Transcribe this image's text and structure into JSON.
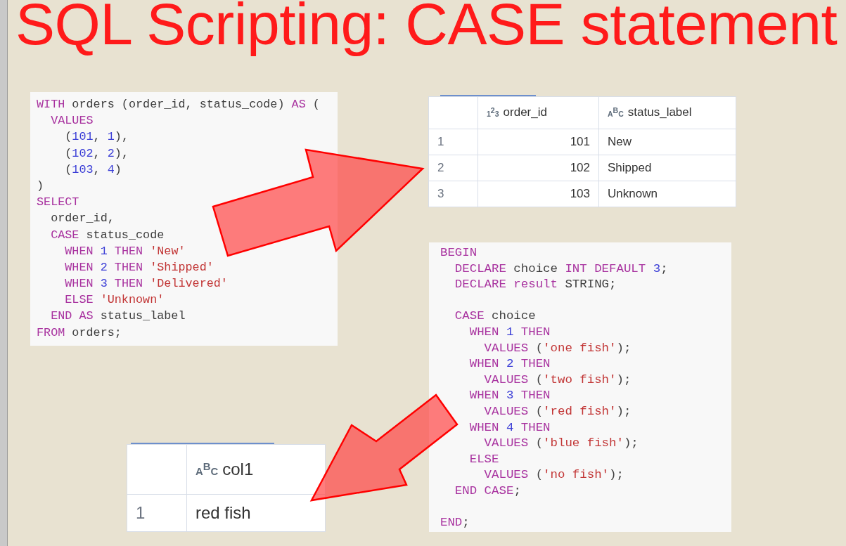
{
  "slide": {
    "title": "SQL Scripting: CASE statement",
    "code_blocks": [
      {
        "lines": [
          {
            "kind": "code",
            "tokens": [
              {
                "kind": "kw",
                "text": "WITH"
              },
              {
                "kind": "plain",
                "text": " orders (order_id, status_code) "
              },
              {
                "kind": "kw",
                "text": "AS"
              },
              {
                "kind": "plain",
                "text": " ("
              }
            ]
          },
          {
            "kind": "code",
            "tokens": [
              {
                "kind": "kw",
                "text": "  VALUES"
              }
            ]
          },
          {
            "kind": "code",
            "tokens": [
              {
                "kind": "plain",
                "text": "    ("
              },
              {
                "kind": "num",
                "text": "101"
              },
              {
                "kind": "plain",
                "text": ", "
              },
              {
                "kind": "num",
                "text": "1"
              },
              {
                "kind": "plain",
                "text": "),"
              }
            ]
          },
          {
            "kind": "code",
            "tokens": [
              {
                "kind": "plain",
                "text": "    ("
              },
              {
                "kind": "num",
                "text": "102"
              },
              {
                "kind": "plain",
                "text": ", "
              },
              {
                "kind": "num",
                "text": "2"
              },
              {
                "kind": "plain",
                "text": "),"
              }
            ]
          },
          {
            "kind": "code",
            "tokens": [
              {
                "kind": "plain",
                "text": "    ("
              },
              {
                "kind": "num",
                "text": "103"
              },
              {
                "kind": "plain",
                "text": ", "
              },
              {
                "kind": "num",
                "text": "4"
              },
              {
                "kind": "plain",
                "text": ")"
              }
            ]
          },
          {
            "kind": "code",
            "tokens": [
              {
                "kind": "plain",
                "text": ")"
              }
            ]
          },
          {
            "kind": "code",
            "tokens": [
              {
                "kind": "kw",
                "text": "SELECT"
              }
            ]
          },
          {
            "kind": "code",
            "tokens": [
              {
                "kind": "plain",
                "text": "  order_id,"
              }
            ]
          },
          {
            "kind": "code",
            "tokens": [
              {
                "kind": "kw",
                "text": "  CASE"
              },
              {
                "kind": "plain",
                "text": " status_code"
              }
            ]
          },
          {
            "kind": "code",
            "tokens": [
              {
                "kind": "kw",
                "text": "    WHEN"
              },
              {
                "kind": "num",
                "text": " 1"
              },
              {
                "kind": "kw",
                "text": " THEN"
              },
              {
                "kind": "str",
                "text": " 'New'"
              }
            ]
          },
          {
            "kind": "code",
            "tokens": [
              {
                "kind": "kw",
                "text": "    WHEN"
              },
              {
                "kind": "num",
                "text": " 2"
              },
              {
                "kind": "kw",
                "text": " THEN"
              },
              {
                "kind": "str",
                "text": " 'Shipped'"
              }
            ]
          },
          {
            "kind": "code",
            "tokens": [
              {
                "kind": "kw",
                "text": "    WHEN"
              },
              {
                "kind": "num",
                "text": " 3"
              },
              {
                "kind": "kw",
                "text": " THEN"
              },
              {
                "kind": "str",
                "text": " 'Delivered'"
              }
            ]
          },
          {
            "kind": "code",
            "tokens": [
              {
                "kind": "kw",
                "text": "    ELSE"
              },
              {
                "kind": "str",
                "text": " 'Unknown'"
              }
            ]
          },
          {
            "kind": "code",
            "tokens": [
              {
                "kind": "kw",
                "text": "  END AS"
              },
              {
                "kind": "plain",
                "text": " status_label"
              }
            ]
          },
          {
            "kind": "code",
            "tokens": [
              {
                "kind": "kw",
                "text": "FROM"
              },
              {
                "kind": "plain",
                "text": " orders;"
              }
            ]
          }
        ]
      },
      {
        "lines": [
          {
            "kind": "code",
            "tokens": [
              {
                "kind": "kw",
                "text": "BEGIN"
              }
            ]
          },
          {
            "kind": "code",
            "tokens": [
              {
                "kind": "kw",
                "text": "  DECLARE"
              },
              {
                "kind": "plain",
                "text": " choice "
              },
              {
                "kind": "kw",
                "text": "INT DEFAULT"
              },
              {
                "kind": "num",
                "text": " 3"
              },
              {
                "kind": "plain",
                "text": ";"
              }
            ]
          },
          {
            "kind": "code",
            "tokens": [
              {
                "kind": "kw",
                "text": "  DECLARE result"
              },
              {
                "kind": "plain",
                "text": " STRING;"
              }
            ]
          },
          {
            "kind": "blank"
          },
          {
            "kind": "code",
            "tokens": [
              {
                "kind": "kw",
                "text": "  CASE"
              },
              {
                "kind": "plain",
                "text": " choice"
              }
            ]
          },
          {
            "kind": "code",
            "tokens": [
              {
                "kind": "kw",
                "text": "    WHEN"
              },
              {
                "kind": "num",
                "text": " 1"
              },
              {
                "kind": "kw",
                "text": " THEN"
              }
            ]
          },
          {
            "kind": "code",
            "tokens": [
              {
                "kind": "kw",
                "text": "      VALUES"
              },
              {
                "kind": "plain",
                "text": " ("
              },
              {
                "kind": "str",
                "text": "'one fish'"
              },
              {
                "kind": "plain",
                "text": ");"
              }
            ]
          },
          {
            "kind": "code",
            "tokens": [
              {
                "kind": "kw",
                "text": "    WHEN"
              },
              {
                "kind": "num",
                "text": " 2"
              },
              {
                "kind": "kw",
                "text": " THEN"
              }
            ]
          },
          {
            "kind": "code",
            "tokens": [
              {
                "kind": "kw",
                "text": "      VALUES"
              },
              {
                "kind": "plain",
                "text": " ("
              },
              {
                "kind": "str",
                "text": "'two fish'"
              },
              {
                "kind": "plain",
                "text": ");"
              }
            ]
          },
          {
            "kind": "code",
            "tokens": [
              {
                "kind": "kw",
                "text": "    WHEN"
              },
              {
                "kind": "num",
                "text": " 3"
              },
              {
                "kind": "kw",
                "text": " THEN"
              }
            ]
          },
          {
            "kind": "code",
            "tokens": [
              {
                "kind": "kw",
                "text": "      VALUES"
              },
              {
                "kind": "plain",
                "text": " ("
              },
              {
                "kind": "str",
                "text": "'red fish'"
              },
              {
                "kind": "plain",
                "text": ");"
              }
            ]
          },
          {
            "kind": "code",
            "tokens": [
              {
                "kind": "kw",
                "text": "    WHEN"
              },
              {
                "kind": "num",
                "text": " 4"
              },
              {
                "kind": "kw",
                "text": " THEN"
              }
            ]
          },
          {
            "kind": "code",
            "tokens": [
              {
                "kind": "kw",
                "text": "      VALUES"
              },
              {
                "kind": "plain",
                "text": " ("
              },
              {
                "kind": "str",
                "text": "'blue fish'"
              },
              {
                "kind": "plain",
                "text": ");"
              }
            ]
          },
          {
            "kind": "code",
            "tokens": [
              {
                "kind": "kw",
                "text": "    ELSE"
              }
            ]
          },
          {
            "kind": "code",
            "tokens": [
              {
                "kind": "kw",
                "text": "      VALUES"
              },
              {
                "kind": "plain",
                "text": " ("
              },
              {
                "kind": "str",
                "text": "'no fish'"
              },
              {
                "kind": "plain",
                "text": ");"
              }
            ]
          },
          {
            "kind": "code",
            "tokens": [
              {
                "kind": "kw",
                "text": "  END CASE"
              },
              {
                "kind": "plain",
                "text": ";"
              }
            ]
          },
          {
            "kind": "blank"
          },
          {
            "kind": "code",
            "tokens": [
              {
                "kind": "kw",
                "text": "END"
              },
              {
                "kind": "plain",
                "text": ";"
              }
            ]
          }
        ]
      }
    ],
    "result_tables": [
      {
        "columns": [
          {
            "kind": "rownum"
          },
          {
            "kind": "number",
            "type_glyph": "123",
            "label": "order_id"
          },
          {
            "kind": "text",
            "type_glyph": "ABC",
            "label": "status_label"
          }
        ],
        "rows": [
          [
            "1",
            "101",
            "New"
          ],
          [
            "2",
            "102",
            "Shipped"
          ],
          [
            "3",
            "103",
            "Unknown"
          ]
        ]
      },
      {
        "columns": [
          {
            "kind": "rownum"
          },
          {
            "kind": "text",
            "type_glyph": "ABC",
            "label": "col1"
          }
        ],
        "rows": [
          [
            "1",
            "red fish"
          ]
        ]
      }
    ]
  }
}
